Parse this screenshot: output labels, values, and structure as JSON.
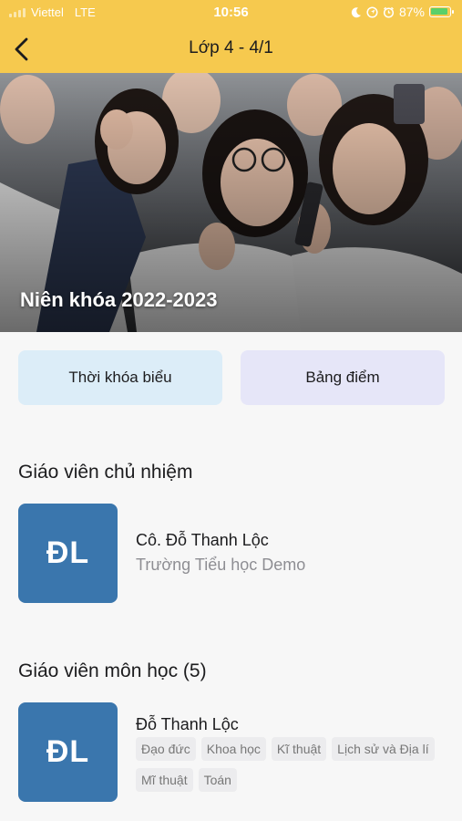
{
  "status_bar": {
    "carrier": "Viettel",
    "network": "LTE",
    "time": "10:56",
    "battery": "87%",
    "icons": [
      "moon-icon",
      "location-icon",
      "alarm-icon",
      "battery-icon"
    ]
  },
  "nav": {
    "title": "Lớp 4 - 4/1",
    "back_icon": "chevron-left-icon"
  },
  "hero": {
    "caption": "Niên khóa 2022-2023"
  },
  "actions": {
    "timetable_label": "Thời khóa biểu",
    "grades_label": "Bảng điểm"
  },
  "homeroom": {
    "section_title": "Giáo viên chủ nhiệm",
    "initials": "ĐL",
    "name": "Cô. Đỗ Thanh Lộc",
    "school": "Trường Tiểu học Demo"
  },
  "subject_teachers": {
    "section_title": "Giáo viên môn học (5)",
    "teachers": [
      {
        "initials": "ĐL",
        "name": "Đỗ Thanh Lộc",
        "subjects": [
          "Đạo đức",
          "Khoa học",
          "Kĩ thuật",
          "Lịch sử và Địa lí",
          "Mĩ thuật",
          "Toán"
        ]
      }
    ]
  },
  "colors": {
    "header": "#f6c94e",
    "avatar": "#3a76ad",
    "timetable_button": "#dcedf8",
    "grades_button": "#e6e6f8"
  }
}
